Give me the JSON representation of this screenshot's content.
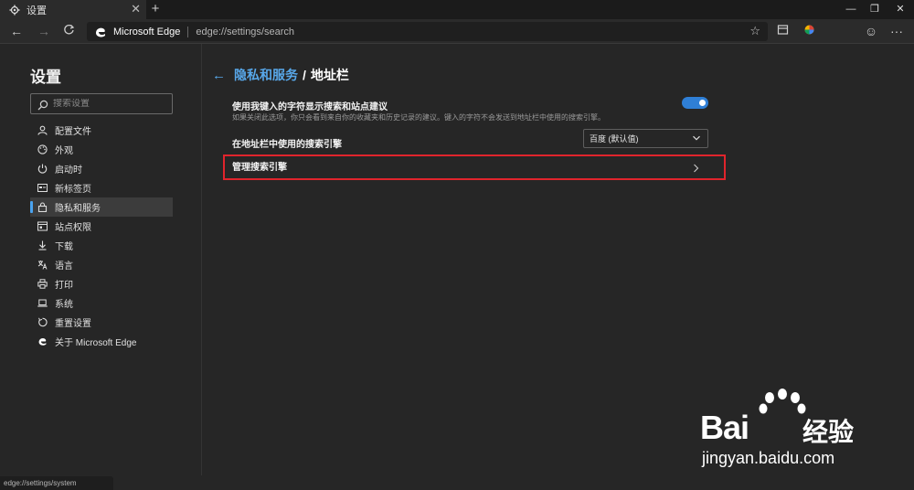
{
  "tab": {
    "title": "设置",
    "close": "✕",
    "newtab": "+"
  },
  "window": {
    "minimize": "—",
    "restore": "❐",
    "close": "✕"
  },
  "address": {
    "brand": "Microsoft Edge",
    "url": "edge://settings/search"
  },
  "sidebar": {
    "title": "设置",
    "search_placeholder": "搜索设置",
    "items": [
      {
        "label": "配置文件",
        "icon": "person-icon"
      },
      {
        "label": "外观",
        "icon": "palette-icon"
      },
      {
        "label": "启动时",
        "icon": "power-icon"
      },
      {
        "label": "新标签页",
        "icon": "newtab-icon"
      },
      {
        "label": "隐私和服务",
        "icon": "lock-icon",
        "active": true
      },
      {
        "label": "站点权限",
        "icon": "site-permissions-icon"
      },
      {
        "label": "下载",
        "icon": "download-icon"
      },
      {
        "label": "语言",
        "icon": "language-icon"
      },
      {
        "label": "打印",
        "icon": "printer-icon"
      },
      {
        "label": "系统",
        "icon": "laptop-icon"
      },
      {
        "label": "重置设置",
        "icon": "reset-icon"
      },
      {
        "label": "关于 Microsoft Edge",
        "icon": "edge-logo-icon"
      }
    ]
  },
  "main": {
    "breadcrumb_parent": "隐私和服务",
    "breadcrumb_sep": "/",
    "breadcrumb_current": "地址栏",
    "suggest_title": "使用我键入的字符显示搜索和站点建议",
    "suggest_desc": "如果关闭此选项，你只会看到来自你的收藏夹和历史记录的建议。键入的字符不会发送到地址栏中使用的搜索引擎。",
    "suggest_enabled": true,
    "engine_label": "在地址栏中使用的搜索引擎",
    "engine_value": "百度 (默认值)",
    "manage_label": "管理搜索引擎"
  },
  "status": {
    "text": "edge://settings/system"
  },
  "watermark": {
    "brand": "Bai",
    "cn": "经验",
    "sub": "jingyan.baidu.com"
  },
  "colors": {
    "accent": "#58a8ea",
    "toggle": "#2f7fd6",
    "highlight": "#e0242c"
  }
}
